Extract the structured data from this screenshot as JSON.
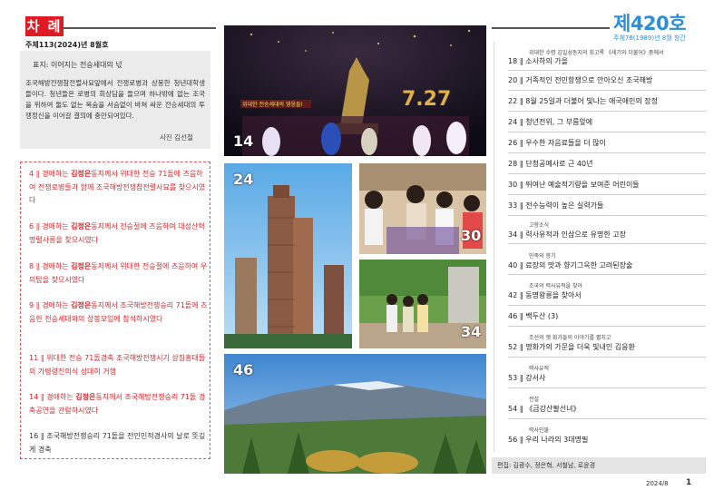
{
  "header": {
    "toc_label": "차 례",
    "issue_line": "주체113(2024)년 8월호",
    "issue_number": "제420호",
    "founded": "주체78(1989)년 8월 창간"
  },
  "cover": {
    "title": "표지: 이어지는 전승세대의 넋",
    "text": "조국해방전쟁참전렬사묘앞에서 전쟁로병과 상봉한 청년대학생들이다. 청년들은 로병의 회상담을 들으며 하나밖에 없는 조국을 위하여 둘도 없는 목숨을 서슴없이 바쳐 싸운 전승세대의 투쟁정신을 이어갈 결의에 충만되여있다.",
    "credit": "사진 김선철"
  },
  "red_items": [
    {
      "num": "4",
      "pre": "경애하는 ",
      "name": "김정은",
      "post": "동지께서 위대한 전승 71돐에 즈음하여 전쟁로병들과 함께 조국해방전쟁참전렬사묘를 찾으시였다"
    },
    {
      "num": "6",
      "pre": "경애하는 ",
      "name": "김정은",
      "post": "동지께서 전승절에 즈음하여 대성산혁명렬사릉을 찾으시였다"
    },
    {
      "num": "8",
      "pre": "경애하는 ",
      "name": "김정은",
      "post": "동지께서 위대한 전승절에 즈음하여 우의탑을 찾으시였다"
    },
    {
      "num": "9",
      "pre": "경애하는 ",
      "name": "김정은",
      "post": "동지께서 조국해방전쟁승리 71돐에 즈음한 전승세대와의 상봉모임에 참석하시였다"
    },
    {
      "num": "11",
      "pre": "",
      "name": "",
      "post": "위대한 전승 71돐경축 조국해방전쟁시기 상징홍대들의 가병령진의식 성대히 거행"
    },
    {
      "num": "14",
      "pre": "경애하는 ",
      "name": "김정은",
      "post": "동지께서 조국해방전쟁승리 71돐 경축공연을 관람하시였다"
    },
    {
      "num": "16",
      "pre": "",
      "name": "",
      "post": "조국해방전쟁승리 71돐을 전인민적경사의 날로 뜻깊게 경축"
    }
  ],
  "photos": {
    "p14": "14",
    "p24": "24",
    "p30": "30",
    "p34": "34",
    "p46": "46",
    "banner": "위대한 전승세대의 영웅들!",
    "date_mark": "7.27"
  },
  "toc": [
    {
      "sub": "위대한 수령 김일성동지의 회고록 《세기와 더불어》중에서",
      "num": "18",
      "title": "소사하의 가을"
    },
    {
      "sub": "",
      "num": "20",
      "title": "거족적인 전민항쟁으로 안아오신 조국해방"
    },
    {
      "sub": "",
      "num": "22",
      "title": "8월 25일과 더불어 빛나는 애국애민의 장정"
    },
    {
      "sub": "",
      "num": "24",
      "title": "청년전위, 그 부름앞에"
    },
    {
      "sub": "",
      "num": "26",
      "title": "우수한 자음료들을 더 많이"
    },
    {
      "sub": "",
      "num": "28",
      "title": "단청공예사로 근 40년"
    },
    {
      "sub": "",
      "num": "30",
      "title": "뛰여난 예술적기량을 보여준 어린이들"
    },
    {
      "sub": "",
      "num": "33",
      "title": "전수능력이 높은 실력가들"
    },
    {
      "sub": "고향소식",
      "num": "34",
      "title": "력사유적과 인삼으로 유명한 고장"
    },
    {
      "sub": "민족의 향기",
      "num": "40",
      "title": "료장의 맛과 향기그윽한 고려된장술"
    },
    {
      "sub": "조국의 력사유적을 찾아",
      "num": "42",
      "title": "동명왕릉을 찾아서"
    },
    {
      "sub": "",
      "num": "46",
      "title": "백두산 (3)"
    },
    {
      "sub": "조선의 옛 화가들의 이야기를 펼치고",
      "num": "52",
      "title": "명화가의 가문을 더욱 빛내인 김응환"
    },
    {
      "sub": "력사유적",
      "num": "53",
      "title": "강서사"
    },
    {
      "sub": "전설",
      "num": "54",
      "title": "《금강산팔선녀》"
    },
    {
      "sub": "력사인물",
      "num": "56",
      "title": "우리 나라의 3대명필"
    }
  ],
  "editors": "편집: 김광수, 정은혁, 서철남, 로윤경",
  "footer": {
    "date": "2024/8",
    "page": "1"
  },
  "colors": {
    "accent_red": "#e01a22",
    "accent_blue": "#2a8fd8"
  }
}
